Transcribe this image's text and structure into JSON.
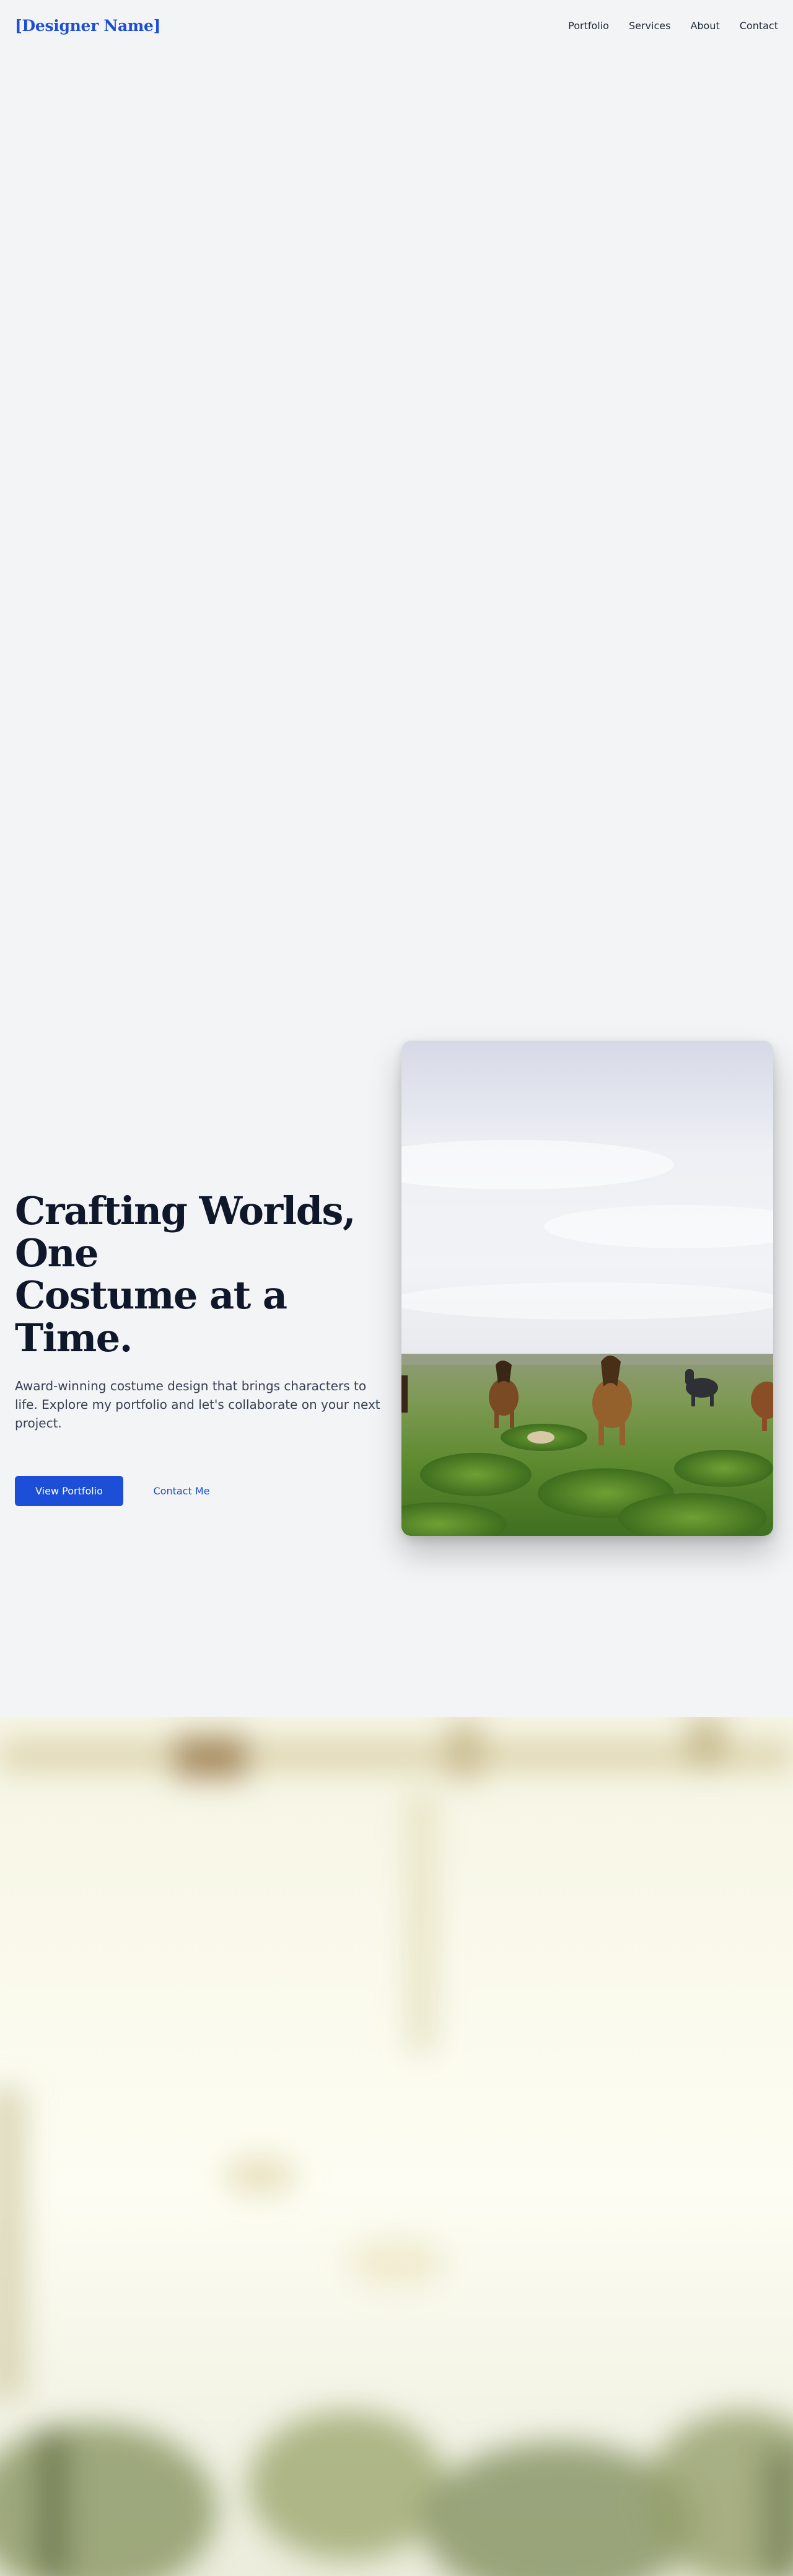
{
  "header": {
    "brand": "[Designer Name]",
    "nav": [
      {
        "label": "Portfolio"
      },
      {
        "label": "Services"
      },
      {
        "label": "About"
      },
      {
        "label": "Contact"
      }
    ]
  },
  "hero": {
    "title_line1": "Crafting Worlds, One",
    "title_line2": "Costume at a Time.",
    "subtitle": "Award-winning costume design that brings characters to life. Explore my portfolio and let's collaborate on your next project.",
    "primary_cta": "View Portfolio",
    "secondary_cta": "Contact Me",
    "image_subject": "horses-in-grassy-field-photo"
  },
  "background_section": {
    "image_subject": "blurred-outdoor-photo"
  },
  "colors": {
    "accent": "#1d4ed8",
    "page_background": "#f3f4f6",
    "heading": "#0f172a",
    "body_text": "#374151"
  }
}
